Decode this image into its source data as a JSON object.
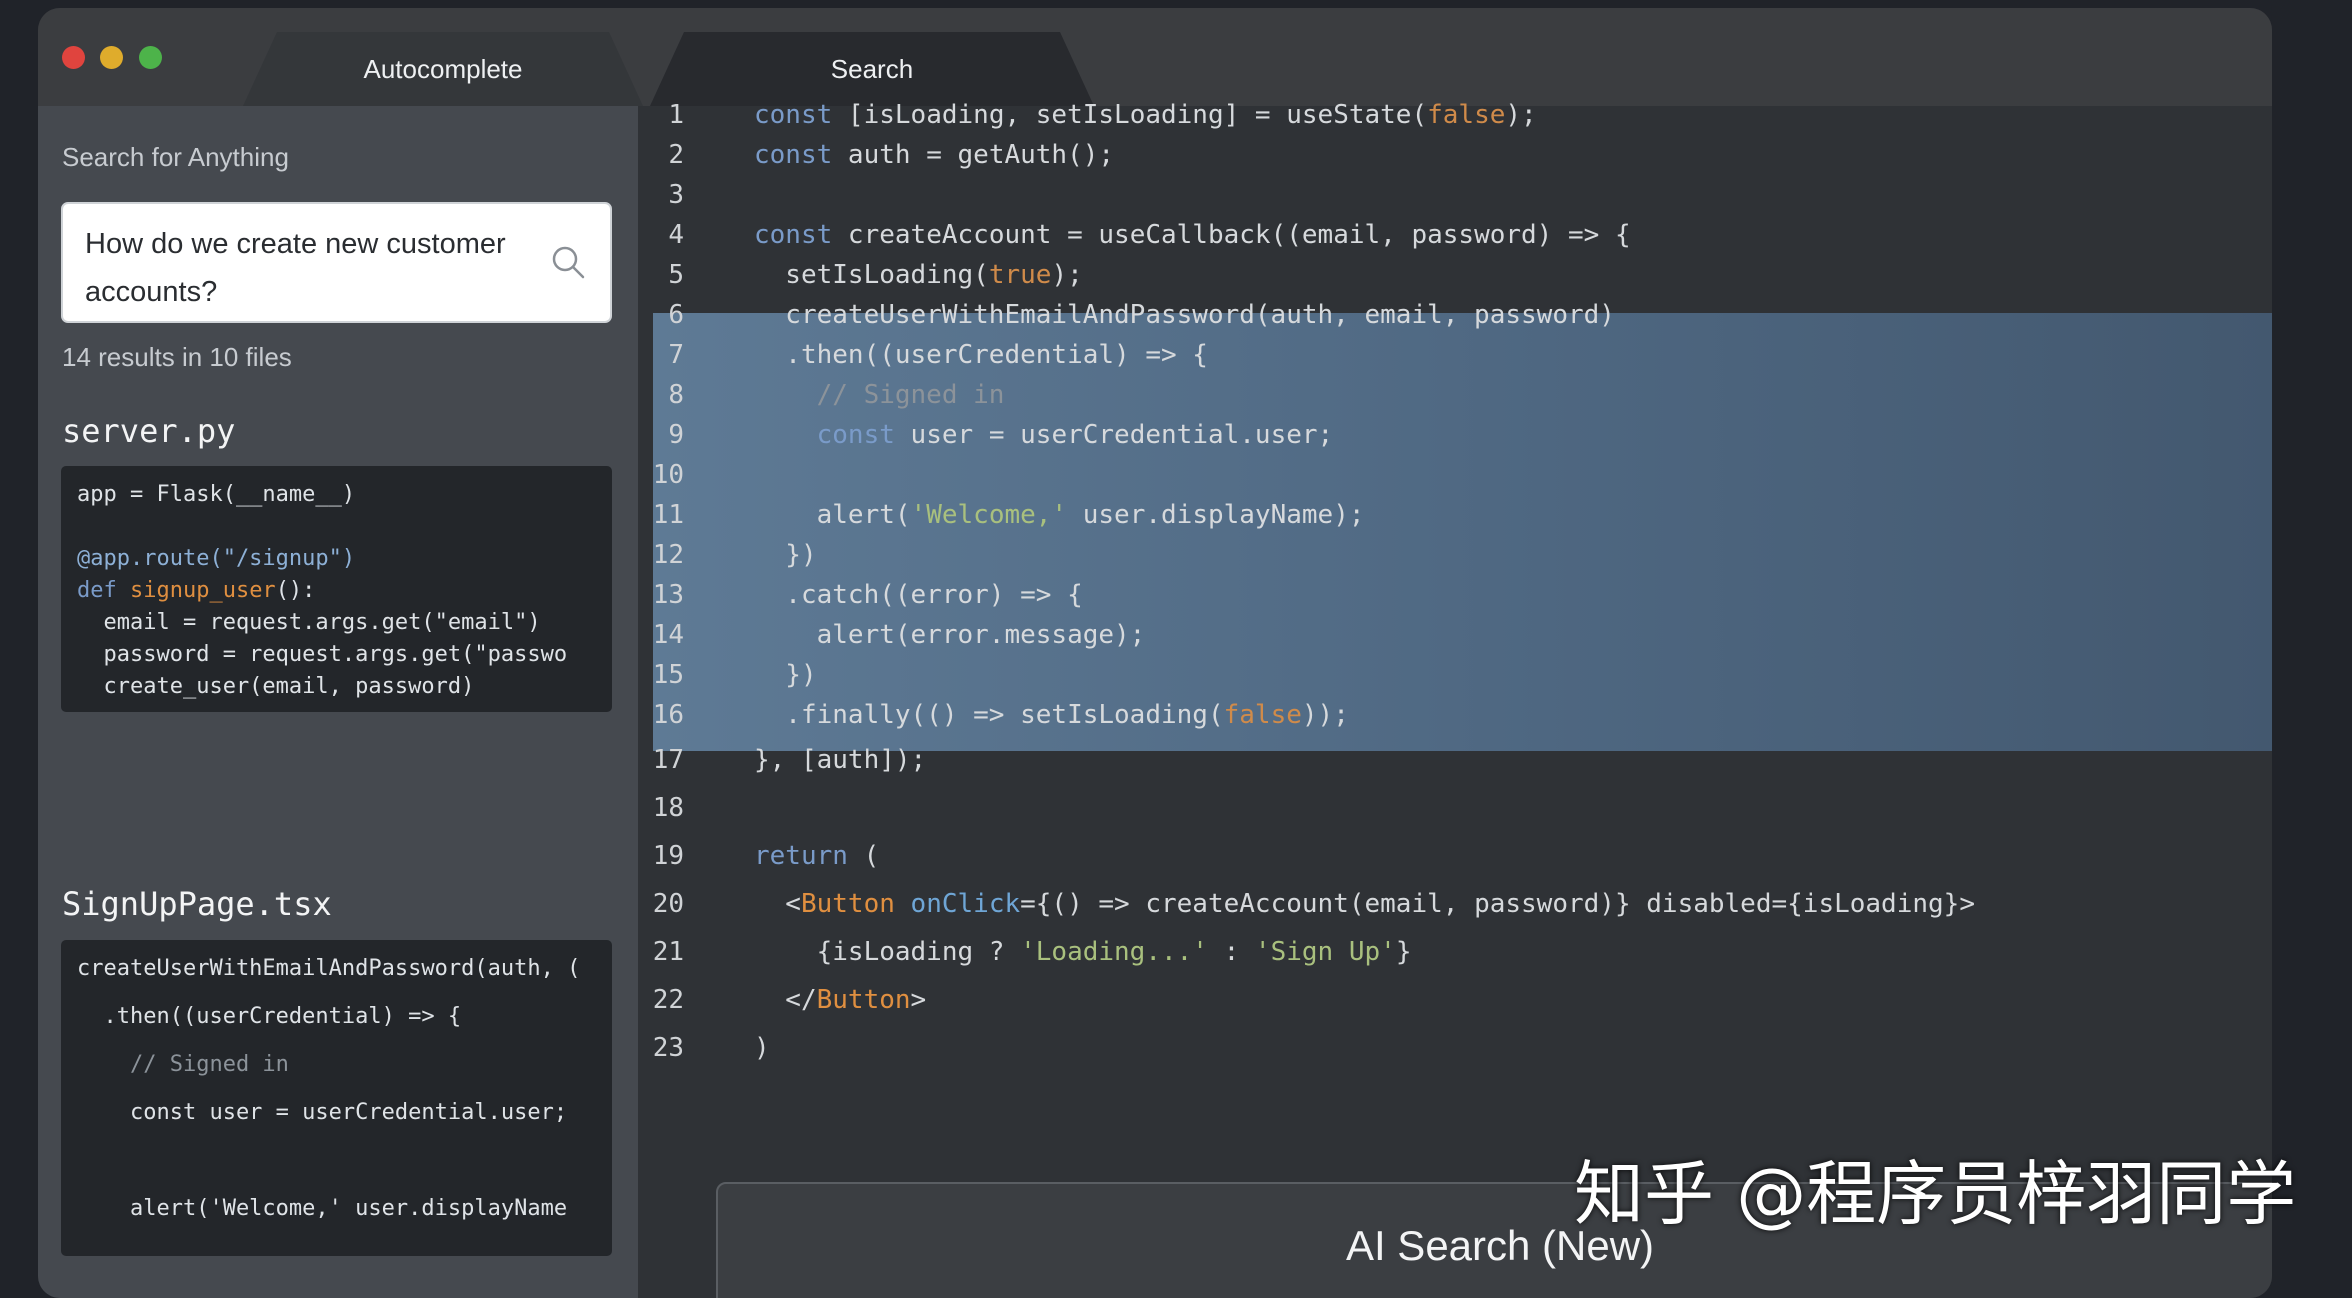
{
  "window": {
    "tabs": [
      {
        "label": "Autocomplete"
      },
      {
        "label": "Search"
      }
    ]
  },
  "sidebar": {
    "label": "Search for Anything",
    "query": "How do we create new customer accounts?",
    "results_summary": "14 results in 10 files",
    "files": [
      {
        "name": "server.py",
        "lines": [
          "app = Flask(__name__)",
          "",
          "@app.route(\"/signup\")",
          "def signup_user():",
          "  email = request.args.get(\"email\")",
          "  password = request.args.get(\"passwo",
          "  create_user(email, password)"
        ]
      },
      {
        "name": "SignUpPage.tsx",
        "lines": [
          "createUserWithEmailAndPassword(auth, (",
          "  .then((userCredential) => {",
          "    // Signed in",
          "    const user = userCredential.user;",
          "",
          "    alert('Welcome,' user.displayName"
        ]
      }
    ]
  },
  "editor": {
    "highlight_lines": [
      6,
      16
    ],
    "lines": [
      {
        "num": "1",
        "text": "const [isLoading, setIsLoading] = useState(false);"
      },
      {
        "num": "2",
        "text": "const auth = getAuth();"
      },
      {
        "num": "3",
        "text": ""
      },
      {
        "num": "4",
        "text": "const createAccount = useCallback((email, password) => {"
      },
      {
        "num": "5",
        "text": "  setIsLoading(true);"
      },
      {
        "num": "6",
        "text": "  createUserWithEmailAndPassword(auth, email, password)"
      },
      {
        "num": "7",
        "text": "  .then((userCredential) => {"
      },
      {
        "num": "8",
        "text": "    // Signed in"
      },
      {
        "num": "9",
        "text": "    const user = userCredential.user;"
      },
      {
        "num": "10",
        "text": ""
      },
      {
        "num": "11",
        "text": "    alert('Welcome,' user.displayName);"
      },
      {
        "num": "12",
        "text": "  })"
      },
      {
        "num": "13",
        "text": "  .catch((error) => {"
      },
      {
        "num": "14",
        "text": "    alert(error.message);"
      },
      {
        "num": "15",
        "text": "  })"
      },
      {
        "num": "16",
        "text": "  .finally(() => setIsLoading(false));"
      },
      {
        "num": "17",
        "text": "}, [auth]);"
      },
      {
        "num": "18",
        "text": ""
      },
      {
        "num": "19",
        "text": "return ("
      },
      {
        "num": "20",
        "text": "  <Button onClick={() => createAccount(email, password)} disabled={isLoading}>"
      },
      {
        "num": "21",
        "text": "    {isLoading ? 'Loading...' : 'Sign Up'}"
      },
      {
        "num": "22",
        "text": "  </Button>"
      },
      {
        "num": "23",
        "text": ")"
      }
    ]
  },
  "ai_panel": {
    "title": "AI Search (New)"
  },
  "watermark": "知乎 @程序员梓羽同学",
  "colors": {
    "keyword": "#7a9bc9",
    "boolean": "#d08b4a",
    "string": "#a9c07e",
    "comment": "#8c939a",
    "highlight": "#5e7a95"
  },
  "icons": [
    "close-dot",
    "minimize-dot",
    "maximize-dot",
    "search-icon"
  ]
}
